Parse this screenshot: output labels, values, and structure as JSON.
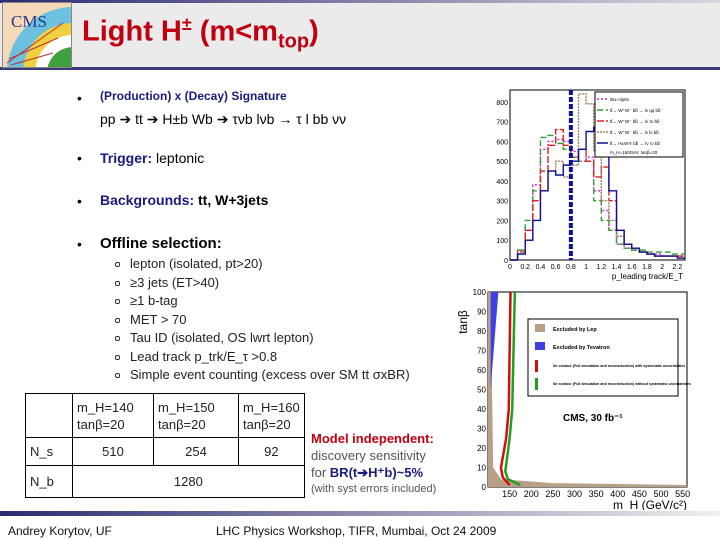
{
  "header": {
    "logo_text": "CMS",
    "title_main": "Light H",
    "title_sup": "±",
    "title_paren": " (m<m",
    "title_sub": "top",
    "title_close": ")"
  },
  "bullets": {
    "production_label": "(Production) x (Decay) Signature",
    "process": "pp ➔ tt ➔ H±b Wb ➔ τνb lνb → τ l bb νν",
    "trigger_label": "Trigger:",
    "trigger_value": " leptonic",
    "backgrounds_label": "Backgrounds:",
    "backgrounds_value": " tt, W+3jets",
    "offline_label": "Offline selection:",
    "selection": [
      "lepton (isolated, pt>20)",
      "≥3 jets (ET>40)",
      "≥1 b-tag",
      "MET > 70",
      "Tau ID (isolated, OS lwrt lepton)",
      "Lead track p_trk/E_τ >0.8",
      "Simple event counting (excess over SM tt σxBR)"
    ]
  },
  "table": {
    "headers": [
      [
        "m_H=140",
        "tanβ=20"
      ],
      [
        "m_H=150",
        "tanβ=20"
      ],
      [
        "m_H=160",
        "tanβ=20"
      ]
    ],
    "rows": [
      {
        "label": "N_s",
        "values": [
          "510",
          "254",
          "92"
        ]
      },
      {
        "label": "N_b",
        "values": [
          "1280"
        ]
      }
    ]
  },
  "note": {
    "title": "Model independent:",
    "line1": "discovery sensitivity",
    "line2_pre": "for ",
    "line2_bold": "BR(t➔H⁺b)~5%",
    "line3": "(with syst errors included)"
  },
  "footer": {
    "author": "Andrey Korytov, UF",
    "event": "LHC Physics Workshop, TIFR, Mumbai, Oct 24 2009"
  },
  "chart_data": [
    {
      "type": "bar",
      "xlabel": "p_leading track/E_T",
      "xlim": [
        0,
        2.3
      ],
      "ylim": [
        0,
        860
      ],
      "xticks": [
        "0",
        "0.2",
        "0.4",
        "0.6",
        "0.8",
        "1",
        "1.2",
        "1.4",
        "1.6",
        "1.8",
        "2",
        "2.2"
      ],
      "yticks": [
        "0",
        "100",
        "200",
        "300",
        "400",
        "500",
        "600",
        "700",
        "800"
      ],
      "cut_line": 0.8,
      "bin_width": 0.1,
      "series": [
        {
          "name": "W±+3jets",
          "color": "#d020d0",
          "dash": "2,2",
          "values": [
            0,
            50,
            150,
            380,
            560,
            600,
            610,
            600,
            550,
            500,
            520,
            350,
            250,
            150,
            80,
            60,
            50,
            40,
            30,
            30,
            20,
            20,
            20
          ]
        },
        {
          "name": "tt̄→ W⁺W⁻ bb̄ → lν qq bb̄",
          "color": "#30a030",
          "dash": "6,3",
          "values": [
            0,
            50,
            200,
            350,
            620,
            630,
            590,
            560,
            520,
            500,
            500,
            300,
            200,
            150,
            80,
            60,
            50,
            50,
            40,
            40,
            40,
            30,
            30
          ]
        },
        {
          "name": "tt̄→ W⁺W⁻ bb̄ → lν τν bb̄",
          "color": "#e02020",
          "dash": "7,2",
          "values": [
            0,
            40,
            150,
            300,
            450,
            580,
            660,
            580,
            520,
            560,
            500,
            420,
            470,
            300,
            150,
            80,
            60,
            40,
            30,
            20,
            20,
            20,
            20
          ]
        },
        {
          "name": "tt̄→ W⁺W⁻ bb̄ → lν lν bb̄",
          "color": "#a08060",
          "dash": "2,1",
          "values": [
            0,
            30,
            100,
            200,
            350,
            450,
            500,
            420,
            480,
            840,
            790,
            550,
            300,
            200,
            120,
            80,
            60,
            40,
            30,
            20,
            20,
            20,
            10
          ]
        },
        {
          "name": "tt̄→ H±W∓ bb̄ → lν τν bb̄",
          "color": "#101090",
          "dash": "",
          "values": [
            0,
            30,
            100,
            200,
            350,
            450,
            430,
            480,
            500,
            560,
            650,
            670,
            540,
            350,
            150,
            80,
            60,
            40,
            30,
            20,
            20,
            20,
            10
          ]
        }
      ],
      "annotation": "m_H=160GeV, tanβ=20"
    },
    {
      "type": "line",
      "xlabel": "m_H (GeV/c²)",
      "ylabel": "tanβ",
      "xlim": [
        100,
        560
      ],
      "ylim": [
        0,
        100
      ],
      "xticks": [
        "150",
        "200",
        "250",
        "300",
        "350",
        "400",
        "450",
        "500",
        "550"
      ],
      "yticks": [
        "0",
        "10",
        "20",
        "30",
        "40",
        "50",
        "60",
        "70",
        "80",
        "90",
        "100"
      ],
      "legend": [
        "Excluded by Lep",
        "Excluded by Tevatron",
        "5σ contour (Full simulation and reconstruction) with systematic uncertainties",
        "5σ contour (Full simulation and reconstruction) without systematic uncertainties"
      ],
      "annotation": "CMS, 30 fb⁻¹",
      "series": [
        {
          "name": "with systematic uncertainties",
          "color": "#d01010",
          "x": [
            152,
            148,
            142,
            130,
            134,
            150
          ],
          "y": [
            100,
            40,
            25,
            10,
            5,
            1
          ]
        },
        {
          "name": "without systematic uncertainties",
          "color": "#20a020",
          "x": [
            162,
            156,
            150,
            140,
            146,
            175
          ],
          "y": [
            100,
            40,
            25,
            8,
            4,
            1
          ]
        }
      ],
      "lep_color": "#b8a088",
      "tevatron_color": "#4040e0"
    }
  ]
}
